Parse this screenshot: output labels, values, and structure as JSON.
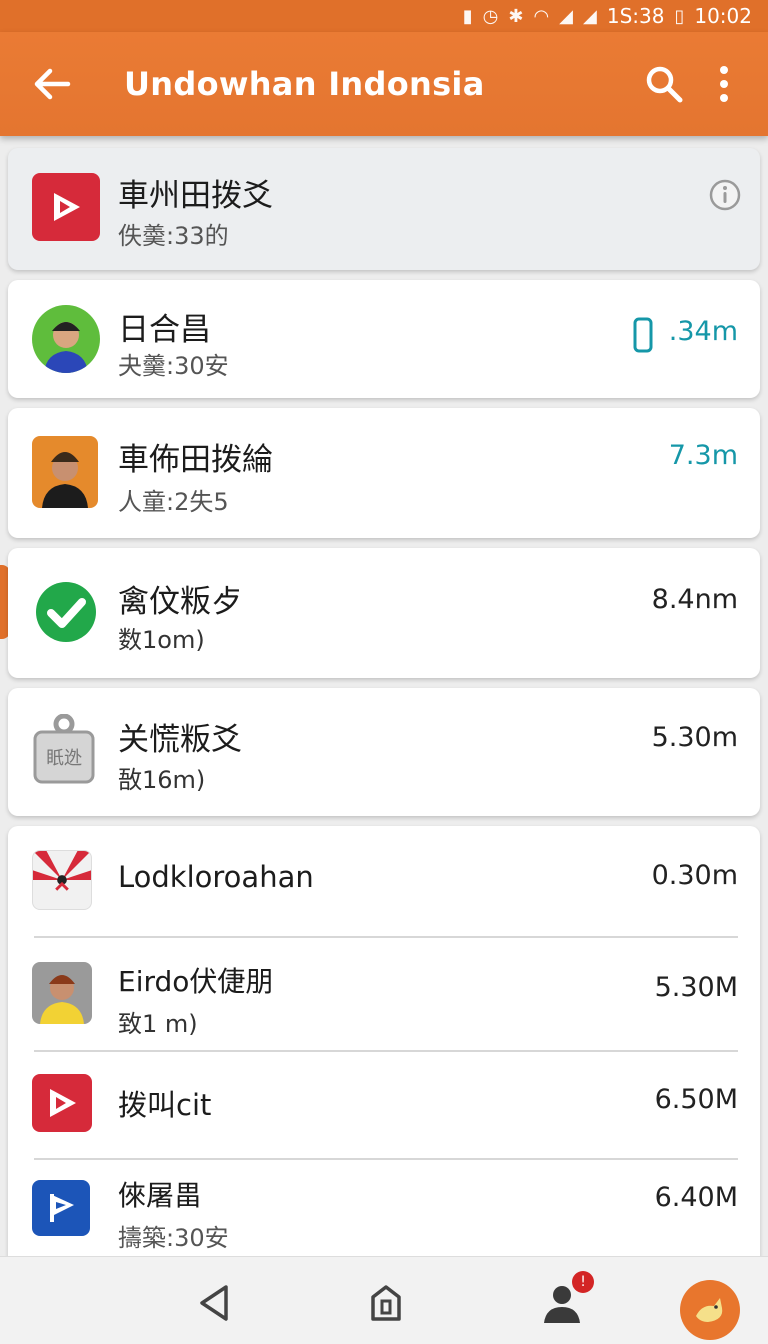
{
  "status_bar": {
    "time_left": "1S:38",
    "time_right": "10:02"
  },
  "app_bar": {
    "title": "Undowhan Indonsia"
  },
  "items": [
    {
      "title": "車州田拨爻",
      "subtitle": "佚羮:33的",
      "value": "",
      "icon": "play-icon"
    },
    {
      "title": "日合昌",
      "subtitle": "夬羹:30安",
      "value": ".34m",
      "icon": "person-avatar"
    },
    {
      "title": "車佈田拨綸",
      "subtitle": "人童:2失5",
      "value": "7.3m",
      "icon": "person-avatar"
    },
    {
      "title": "禽伩粄歺",
      "subtitle": "数1om)",
      "value": "8.4nm",
      "icon": "check-icon"
    },
    {
      "title": "关慌粄爻",
      "subtitle": "敔16m)",
      "value": "5.30m",
      "icon": "lock-icon",
      "icon_text": "眂迯"
    },
    {
      "title": "Lodkloroahan",
      "subtitle": "",
      "value": "0.30m",
      "icon": "app-icon"
    },
    {
      "title": "Eirdo伏倢朋",
      "subtitle": "致1 m)",
      "value": "5.30M",
      "icon": "person-avatar"
    },
    {
      "title": "拨叫cit",
      "subtitle": "",
      "value": "6.50M",
      "icon": "play-icon"
    },
    {
      "title": "倈屠畕",
      "subtitle": "擣築:30安",
      "value": "6.40M",
      "icon": "flag-icon"
    }
  ],
  "nav": {
    "badge": "!"
  },
  "colors": {
    "accent": "#e8762d",
    "teal": "#1597a8",
    "red": "#d62a3a",
    "blue": "#1c55b8"
  }
}
